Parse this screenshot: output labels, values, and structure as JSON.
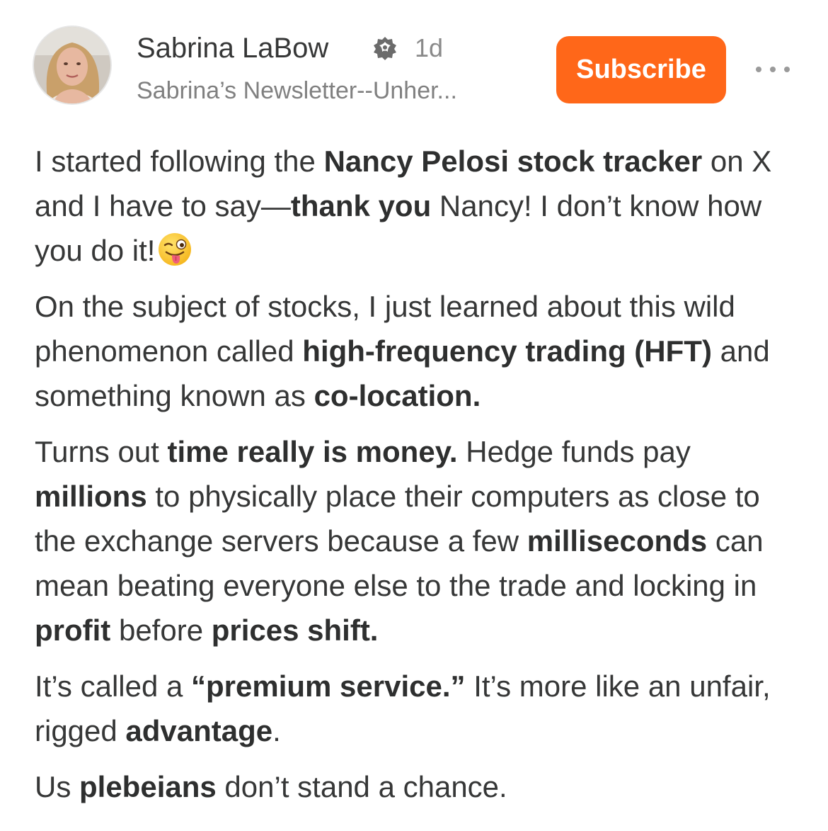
{
  "author": {
    "name": "Sabrina LaBow",
    "time": "1d",
    "publication": "Sabrina’s Newsletter--Unher..."
  },
  "header": {
    "subscribe_label": "Subscribe",
    "more_label": "•••"
  },
  "colors": {
    "accent": "#ff6719",
    "text": "#363737",
    "muted": "#808080"
  },
  "icons": {
    "verified": "verified-badge-icon",
    "more": "more-options-icon",
    "emoji": "winking-face-with-tongue-emoji"
  },
  "post": {
    "p1": {
      "t1": "I started following the ",
      "b1": "Nancy Pelosi stock tracker",
      "t2": " on X and I have to say—",
      "b2": "thank you",
      "t3": " Nancy! I don’t know how you do it!"
    },
    "p2": {
      "t1": "On the subject of stocks, I just learned about this wild phenomenon called ",
      "b1": "high-frequency trading (HFT)",
      "t2": " and something known as ",
      "b2": "co-location."
    },
    "p3": {
      "t1": "Turns out ",
      "b1": "time really is money.",
      "t2": " Hedge funds pay ",
      "b2": "millions",
      "t3": " to physically place their computers as close to the exchange servers because a few ",
      "b3": "milliseconds",
      "t4": " can mean beating everyone else to the trade and locking in ",
      "b4": "profit",
      "t5": " before ",
      "b5": "prices shift."
    },
    "p4": {
      "t1": "It’s called a ",
      "b1": "“premium service.”",
      "t2": " It’s more like an unfair, rigged ",
      "b2": "advantage",
      "t3": "."
    },
    "p5": {
      "t1": "Us ",
      "b1": "plebeians",
      "t2": " don’t stand a chance."
    }
  }
}
